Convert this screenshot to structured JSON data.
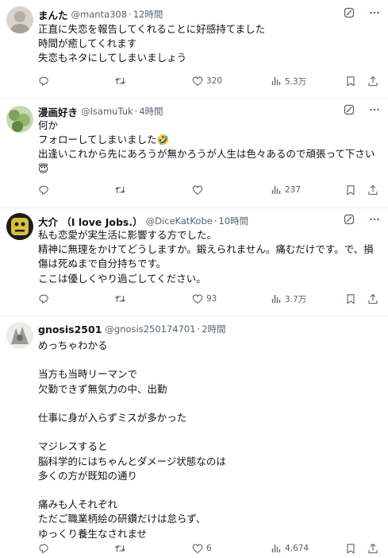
{
  "colors": {
    "text": "#0f1419",
    "muted": "#536471",
    "divider": "#eff3f4"
  },
  "icons": {
    "grok": "grok-icon",
    "more": "more-icon",
    "reply": "reply-icon",
    "retweet": "retweet-icon",
    "like": "like-icon",
    "views": "views-icon",
    "bookmark": "bookmark-icon",
    "share": "share-icon"
  },
  "tweets": [
    {
      "name": "まんた",
      "handle": "@manta308",
      "time": "12時間",
      "lines": [
        "正直に失恋を報告してくれることに好感持てました",
        "時間が癒してくれます",
        "失恋もネタにしてしまいましょう"
      ],
      "reply": "",
      "retweet": "",
      "likes": "320",
      "views": "5.3万"
    },
    {
      "name": "漫画好き",
      "handle": "@IsamuTuk",
      "time": "4時間",
      "lines": [
        "何か",
        "フォローしてしまいました🤣",
        "出逢いこれから先にあろうが無かろうが人生は色々あるので頑張って下さい",
        "😇"
      ],
      "reply": "",
      "retweet": "",
      "likes": "",
      "views": "237"
    },
    {
      "name": "大介 （I love Jobs.）",
      "handle": "@DiceKatKobe",
      "time": "10時間",
      "lines": [
        "私も恋愛が実生活に影響する方でした。",
        "精神に無理をかけてどうしますか。鍛えられません。痛むだけです。で、損",
        "傷は死ぬまで自分持ちです。",
        "ここは優しくやり過ごしてください。"
      ],
      "reply": "",
      "retweet": "",
      "likes": "93",
      "views": "3.7万"
    },
    {
      "name": "gnosis2501",
      "handle": "@gnosis250174701",
      "time": "2時間",
      "lines": [
        "めっちゃわかる",
        "",
        "当方も当時リーマンで",
        "欠勤できず無気力の中、出勤",
        "",
        "仕事に身が入らずミスが多かった",
        "",
        "マジレスすると",
        "脳科学的にはちゃんとダメージ状態なのは",
        "多くの方が既知の通り",
        "",
        "痛みも人それぞれ",
        "ただご職業柄絵の研鑽だけは怠らず、",
        "ゆっくり養生なされませ"
      ],
      "reply": "",
      "retweet": "",
      "likes": "6",
      "views": "4,674"
    }
  ]
}
